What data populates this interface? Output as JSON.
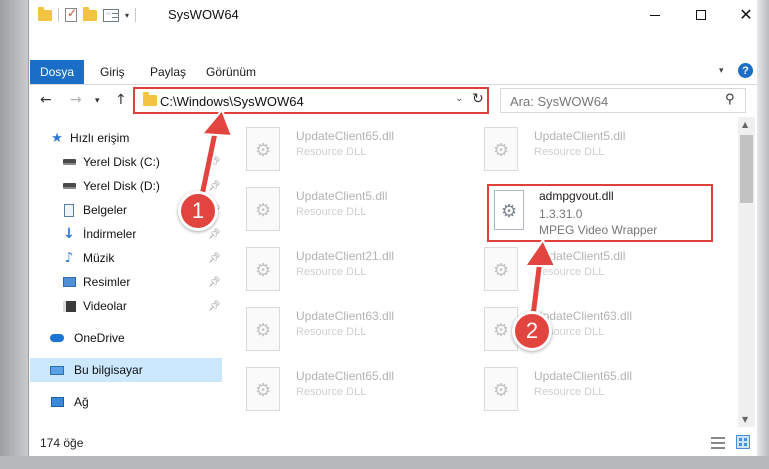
{
  "window": {
    "title": "SysWOW64"
  },
  "ribbon": {
    "tabs": [
      "Dosya",
      "Giriş",
      "Paylaş",
      "Görünüm"
    ],
    "help": "?"
  },
  "nav": {
    "address": "C:\\Windows\\SysWOW64",
    "search_placeholder": "Ara: SysWOW64"
  },
  "sidebar": {
    "items": [
      {
        "label": "Hızlı erişim",
        "icon": "star-icon",
        "pinned": false
      },
      {
        "label": "Yerel Disk (C:)",
        "icon": "drive-icon",
        "pinned": true
      },
      {
        "label": "Yerel Disk (D:)",
        "icon": "drive-icon",
        "pinned": true
      },
      {
        "label": "Belgeler",
        "icon": "document-icon",
        "pinned": true
      },
      {
        "label": "İndirmeler",
        "icon": "download-icon",
        "pinned": true
      },
      {
        "label": "Müzik",
        "icon": "music-icon",
        "pinned": true
      },
      {
        "label": "Resimler",
        "icon": "pictures-icon",
        "pinned": true
      },
      {
        "label": "Videolar",
        "icon": "videos-icon",
        "pinned": true
      },
      {
        "label": "OneDrive",
        "icon": "onedrive-icon",
        "pinned": false
      },
      {
        "label": "Bu bilgisayar",
        "icon": "computer-icon",
        "pinned": false,
        "selected": true
      },
      {
        "label": "Ağ",
        "icon": "network-icon",
        "pinned": false
      }
    ]
  },
  "files": {
    "left": [
      {
        "name": "UpdateClient65.dll",
        "desc": "Resource DLL"
      },
      {
        "name": "UpdateClient5.dll",
        "desc": "Resource DLL"
      },
      {
        "name": "UpdateClient21.dll",
        "desc": "Resource DLL"
      },
      {
        "name": "UpdateClient63.dll",
        "desc": "Resource DLL"
      },
      {
        "name": "UpdateClient65.dll",
        "desc": "Resource DLL"
      }
    ],
    "right": [
      {
        "name": "UpdateClient5.dll",
        "desc": "Resource DLL"
      },
      {
        "name": "UpdateClient5.dll",
        "desc": "Resource DLL"
      },
      {
        "name": "UpdateClient63.dll",
        "desc": "Resource DLL"
      },
      {
        "name": "UpdateClient65.dll",
        "desc": "Resource DLL"
      }
    ],
    "highlighted": {
      "name": "admpgvout.dll",
      "version": "1.3.31.0",
      "desc": "MPEG Video Wrapper"
    }
  },
  "status": {
    "count": "174 öğe"
  },
  "callouts": {
    "step1": "1",
    "step2": "2",
    "color": "#e2443f"
  }
}
